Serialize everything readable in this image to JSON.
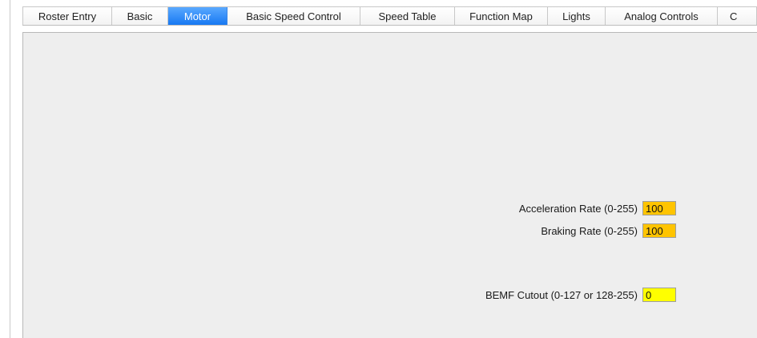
{
  "tabs": [
    {
      "label": "Roster Entry",
      "selected": false
    },
    {
      "label": "Basic",
      "selected": false
    },
    {
      "label": "Motor",
      "selected": true
    },
    {
      "label": "Basic Speed Control",
      "selected": false
    },
    {
      "label": "Speed Table",
      "selected": false
    },
    {
      "label": "Function Map",
      "selected": false
    },
    {
      "label": "Lights",
      "selected": false
    },
    {
      "label": "Analog Controls",
      "selected": false
    },
    {
      "label": "C",
      "selected": false
    }
  ],
  "motor": {
    "acceleration": {
      "label": "Acceleration Rate (0-255)",
      "value": "100",
      "color": "#ffc400"
    },
    "braking": {
      "label": "Braking Rate (0-255)",
      "value": "100",
      "color": "#ffc400"
    },
    "bemf": {
      "label": "BEMF Cutout (0-127 or 128-255)",
      "value": "0",
      "color": "#ffff00"
    }
  },
  "colors": {
    "selected_tab": "#1778f2",
    "panel_bg": "#eeeeee"
  }
}
